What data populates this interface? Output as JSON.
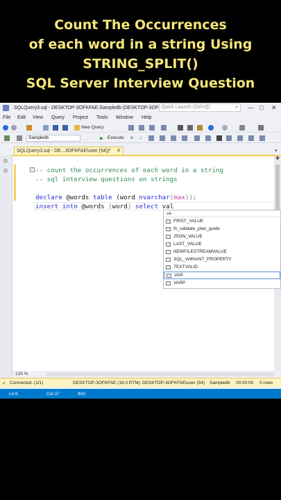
{
  "overlay_title": [
    "Count The Occurrences",
    "of each word in a string Using",
    "STRING_SPLIT()",
    "SQL Server  Interview Question"
  ],
  "window": {
    "title": "SQLQuery3.sql - DESKTOP-3OFKFAE.Sampledb (DESKTOP-3OFK...",
    "quick_launch": "Quick Launch (Ctrl+Q)",
    "min": "—",
    "max": "□",
    "close": "✕"
  },
  "menu": [
    "File",
    "Edit",
    "View",
    "Query",
    "Project",
    "Tools",
    "Window",
    "Help"
  ],
  "toolbar": {
    "new_query": "New Query",
    "database": "Sampledb",
    "execute": "Execute"
  },
  "tab": {
    "label": "SQLQuery3.sql - DE...3OFKFAE\\user (54))*",
    "close": "✕"
  },
  "editor": {
    "comment1": "-- count the occurrences of each word in a string",
    "comment2": "-- sql interview questions on strings",
    "l3_kw1": "declare",
    "l3_txt1": " @words ",
    "l3_kw2": "table",
    "l3_txt2": " (word ",
    "l3_kw3": "nvarchar",
    "l3_p1": "(",
    "l3_fn": "max",
    "l3_p2": "));",
    "l4_kw1": "insert into",
    "l4_txt1": " @words ",
    "l4_p1": "(",
    "l4_txt2": "word",
    "l4_p2": ")",
    "l4_sp": " ",
    "l4_kw2": "select",
    "l4_txt3": " val"
  },
  "autocomplete": {
    "filter": "va",
    "items": [
      "FIRST_VALUE",
      "fn_validate_plan_guide",
      "JSON_VALUE",
      "LAST_VALUE",
      "NEWFILESTREAMVALUE",
      "SQL_VARIANT_PROPERTY",
      "TEXTVALID",
      "VAR",
      "VARP"
    ],
    "selected_index": 7
  },
  "zoom": "133 %",
  "status": {
    "connected": "Connected. (1/1)",
    "server": "DESKTOP-3OFKFAE (16.0 RTM)",
    "user": "DESKTOP-3OFKFAE\\user (54)",
    "db": "Sampledb",
    "time": "00:00:00",
    "rows": "0 rows"
  },
  "bottom": {
    "ln": "Ln 6",
    "col": "Col 37",
    "ins": "INS"
  },
  "colors": {
    "accent": "#007acc",
    "tab": "#fdf4bf",
    "title_text": "#f5e67a"
  }
}
